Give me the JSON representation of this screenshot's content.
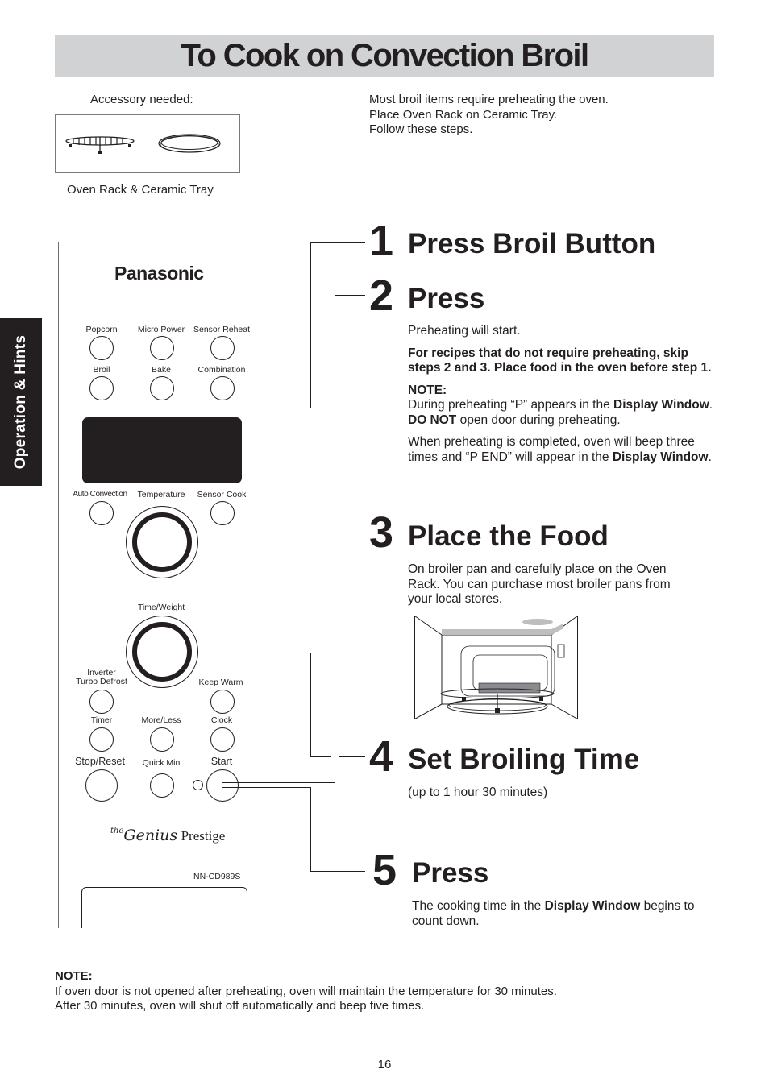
{
  "page": {
    "title": "To Cook on Convection Broil",
    "page_number": "16",
    "side_tab": "Operation & Hints"
  },
  "accessory": {
    "label": "Accessory needed:",
    "caption": "Oven Rack & Ceramic Tray",
    "items": [
      "oven-rack",
      "ceramic-tray"
    ]
  },
  "intro": {
    "lines": [
      "Most broil items require preheating the oven.",
      "Place Oven Rack on Ceramic Tray.",
      "Follow these steps."
    ]
  },
  "control_panel": {
    "brand": "Panasonic",
    "series_prefix": "the",
    "series_script": "Genius",
    "series_name": "Prestige",
    "model": "NN-CD989S",
    "buttons": {
      "popcorn": "Popcorn",
      "micro_power": "Micro Power",
      "sensor_reheat": "Sensor Reheat",
      "broil": "Broil",
      "bake": "Bake",
      "combination": "Combination",
      "auto_convection": "Auto Convection",
      "temperature": "Temperature",
      "sensor_cook": "Sensor Cook",
      "time_weight": "Time/Weight",
      "inverter_line1": "Inverter",
      "inverter_line2": "Turbo Defrost",
      "keep_warm": "Keep Warm",
      "timer": "Timer",
      "more_less": "More/Less",
      "clock": "Clock",
      "stop_reset": "Stop/Reset",
      "quick_min": "Quick Min",
      "start": "Start"
    }
  },
  "steps": [
    {
      "number": "1",
      "title": "Press Broil Button"
    },
    {
      "number": "2",
      "title": "Press",
      "text": "Preheating will start.",
      "bold_note": "For recipes that do not require preheating, skip steps 2 and 3. Place food in the oven before step 1.",
      "note_label": "NOTE:",
      "note_p1_a": "During preheating “P” appears in the ",
      "note_p1_b": "Display Window",
      "note_p1_c": ". ",
      "note_p1_d": "DO NOT",
      "note_p1_e": " open door during preheating.",
      "note_p2_a": "When preheating is completed, oven will beep three times and “P END” will appear in the ",
      "note_p2_b": "Display Window",
      "note_p2_c": "."
    },
    {
      "number": "3",
      "title": "Place the Food",
      "text": "On broiler pan and carefully place on the Oven Rack. You can purchase most broiler pans from your local stores."
    },
    {
      "number": "4",
      "title": "Set Broiling Time",
      "text": "(up to 1 hour 30 minutes)"
    },
    {
      "number": "5",
      "title": "Press",
      "text_a": "The cooking time in the ",
      "text_b": "Display Window",
      "text_c": " begins to count down."
    }
  ],
  "footer_note": {
    "label": "NOTE:",
    "line1": "If oven door is not opened after preheating, oven will maintain the temperature for 30 minutes.",
    "line2": "After 30 minutes, oven will shut off automatically and beep five times."
  }
}
